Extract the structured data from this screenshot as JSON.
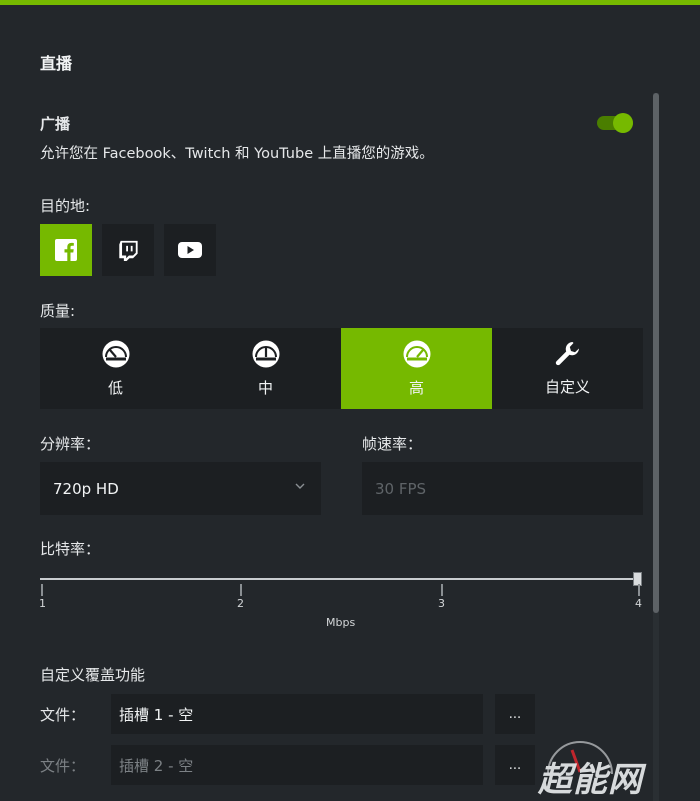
{
  "title": "直播",
  "broadcast": {
    "label": "广播",
    "description": "允许您在 Facebook、Twitch 和 YouTube 上直播您的游戏。",
    "enabled": true
  },
  "destination": {
    "label": "目的地:",
    "options": [
      {
        "name": "Facebook",
        "icon": "facebook-icon",
        "selected": true
      },
      {
        "name": "Twitch",
        "icon": "twitch-icon",
        "selected": false
      },
      {
        "name": "YouTube",
        "icon": "youtube-icon",
        "selected": false
      }
    ]
  },
  "quality": {
    "label": "质量:",
    "options": [
      {
        "label": "低",
        "icon": "gauge-low-icon",
        "selected": false
      },
      {
        "label": "中",
        "icon": "gauge-medium-icon",
        "selected": false
      },
      {
        "label": "高",
        "icon": "gauge-high-icon",
        "selected": true
      },
      {
        "label": "自定义",
        "icon": "wrench-icon",
        "selected": false
      }
    ]
  },
  "resolution": {
    "label": "分辨率：",
    "value": "720p HD"
  },
  "framerate": {
    "label": "帧速率：",
    "value": "30 FPS",
    "disabled": true
  },
  "bitrate": {
    "label": "比特率：",
    "ticks": [
      "1",
      "2",
      "3",
      "4"
    ],
    "unit": "Mbps",
    "value": 4
  },
  "overlay": {
    "label": "自定义覆盖功能",
    "files": [
      {
        "label": "文件：",
        "value": "插槽 1 - 空",
        "button": "..."
      },
      {
        "label": "文件：",
        "value": "插槽 2 - 空",
        "button": "..."
      }
    ]
  },
  "watermark": {
    "text": "超能网"
  },
  "colors": {
    "accent": "#76b900",
    "background": "#23272b",
    "panel": "#1c1f22"
  }
}
